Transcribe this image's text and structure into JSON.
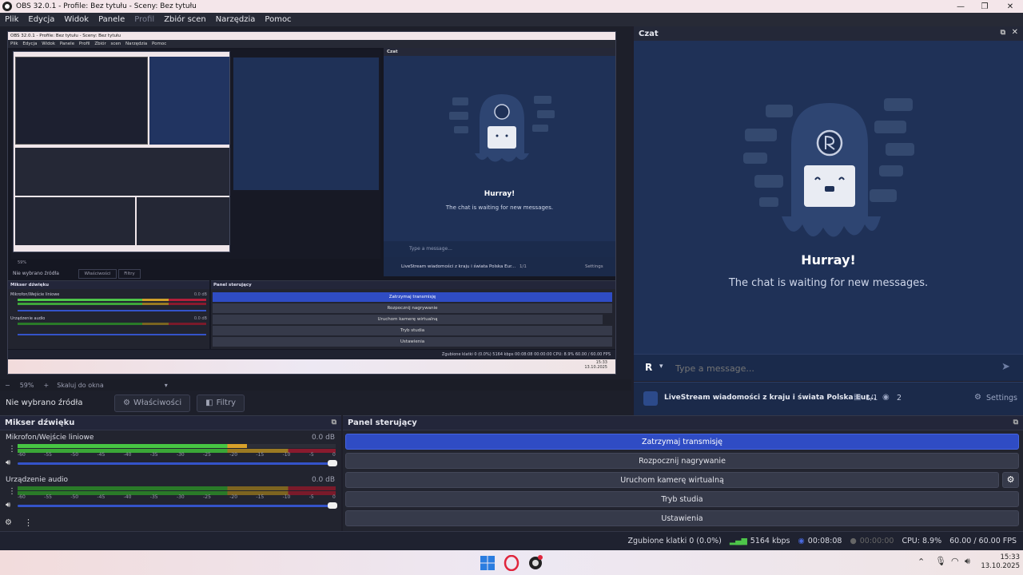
{
  "window": {
    "title": "OBS 32.0.1 - Profile: Bez tytułu - Sceny: Bez tytułu",
    "controls": {
      "minimize": "—",
      "maximize": "❐",
      "close": "✕"
    }
  },
  "menu": {
    "items": [
      "Plik",
      "Edycja",
      "Widok",
      "Panele",
      "Profil",
      "Zbiór scen",
      "Narzędzia",
      "Pomoc"
    ]
  },
  "preview": {
    "nested_title": "OBS 32.0.1 - Profile: Bez tytułu - Sceny: Bez tytułu",
    "nested_menu": [
      "Plik",
      "Edycja",
      "Widok",
      "Panele",
      "Profil",
      "Zbiór scen",
      "Narzędzia",
      "Pomoc"
    ],
    "nested_chat_title": "Czat",
    "nested_hurray": "Hurray!",
    "nested_waiting": "The chat is waiting for new messages.",
    "nested_input": "Type a message...",
    "nested_stream": "LiveStream wiadomości z kraju i świata Polska Eur...",
    "nested_viewers": "1/1",
    "nested_watch": "2",
    "nested_settings": "Settings",
    "nested_no_source": "Nie wybrano źródła",
    "nested_properties": "Właściwości",
    "nested_filters": "Filtry",
    "nested_mixer": "Mikser dźwięku",
    "nested_controls": "Panel sterujący",
    "nested_mic": "Mikrofon/Wejście liniowe",
    "nested_audio": "Urządzenie audio",
    "nested_db": "0.0 dB",
    "nested_buttons": [
      "Zatrzymaj transmisję",
      "Rozpocznij nagrywanie",
      "Uruchom kamerę wirtualną",
      "Tryb studia",
      "Ustawienia"
    ],
    "nested_status": "Zgubione klatki 0 (0.0%)   5164 kbps   00:08:08   00:00:00   CPU: 8.9%   60.00 / 60.00 FPS",
    "nested_zoom": "59%",
    "nested_scale": "Skaluj do okna",
    "nested_time": "15:33",
    "nested_date": "13.10.2025"
  },
  "zoom": {
    "minus": "−",
    "value": "59%",
    "plus": "+",
    "scale": "Skaluj do okna"
  },
  "chat": {
    "title": "Czat",
    "hurray": "Hurray!",
    "waiting": "The chat is waiting for new messages.",
    "input_placeholder": "Type a message...",
    "avatar_letter": "R",
    "stream_title": "LiveStream wiadomości z kraju i świata Polska Eur...",
    "viewers": "1/1",
    "watching": "2",
    "settings": "Settings",
    "brand_color": "#1f3157",
    "accent_color": "#2f4cc4"
  },
  "sources": {
    "label": "Nie wybrano źródła",
    "properties": "Właściwości",
    "filters": "Filtry"
  },
  "mixer": {
    "title": "Mikser dźwięku",
    "tracks": [
      {
        "name": "Mikrofon/Wejście liniowe",
        "db": "0.0 dB",
        "level_fraction": 0.72
      },
      {
        "name": "Urządzenie audio",
        "db": "0.0 dB",
        "level_fraction": 0.0
      }
    ],
    "ticks": [
      "-60",
      "-55",
      "-50",
      "-45",
      "-40",
      "-35",
      "-30",
      "-25",
      "-20",
      "-15",
      "-10",
      "-5",
      "0"
    ]
  },
  "controls": {
    "title": "Panel sterujący",
    "buttons": [
      "Zatrzymaj transmisję",
      "Rozpocznij nagrywanie",
      "Uruchom kamerę wirtualną",
      "Tryb studia",
      "Ustawienia"
    ]
  },
  "status": {
    "dropped": "Zgubione klatki 0 (0.0%)",
    "bitrate": "5164 kbps",
    "stream_time": "00:08:08",
    "rec_time": "00:00:00",
    "cpu": "CPU: 8.9%",
    "fps": "60.00 / 60.00 FPS"
  },
  "taskbar": {
    "time": "15:33",
    "date": "13.10.2025"
  }
}
